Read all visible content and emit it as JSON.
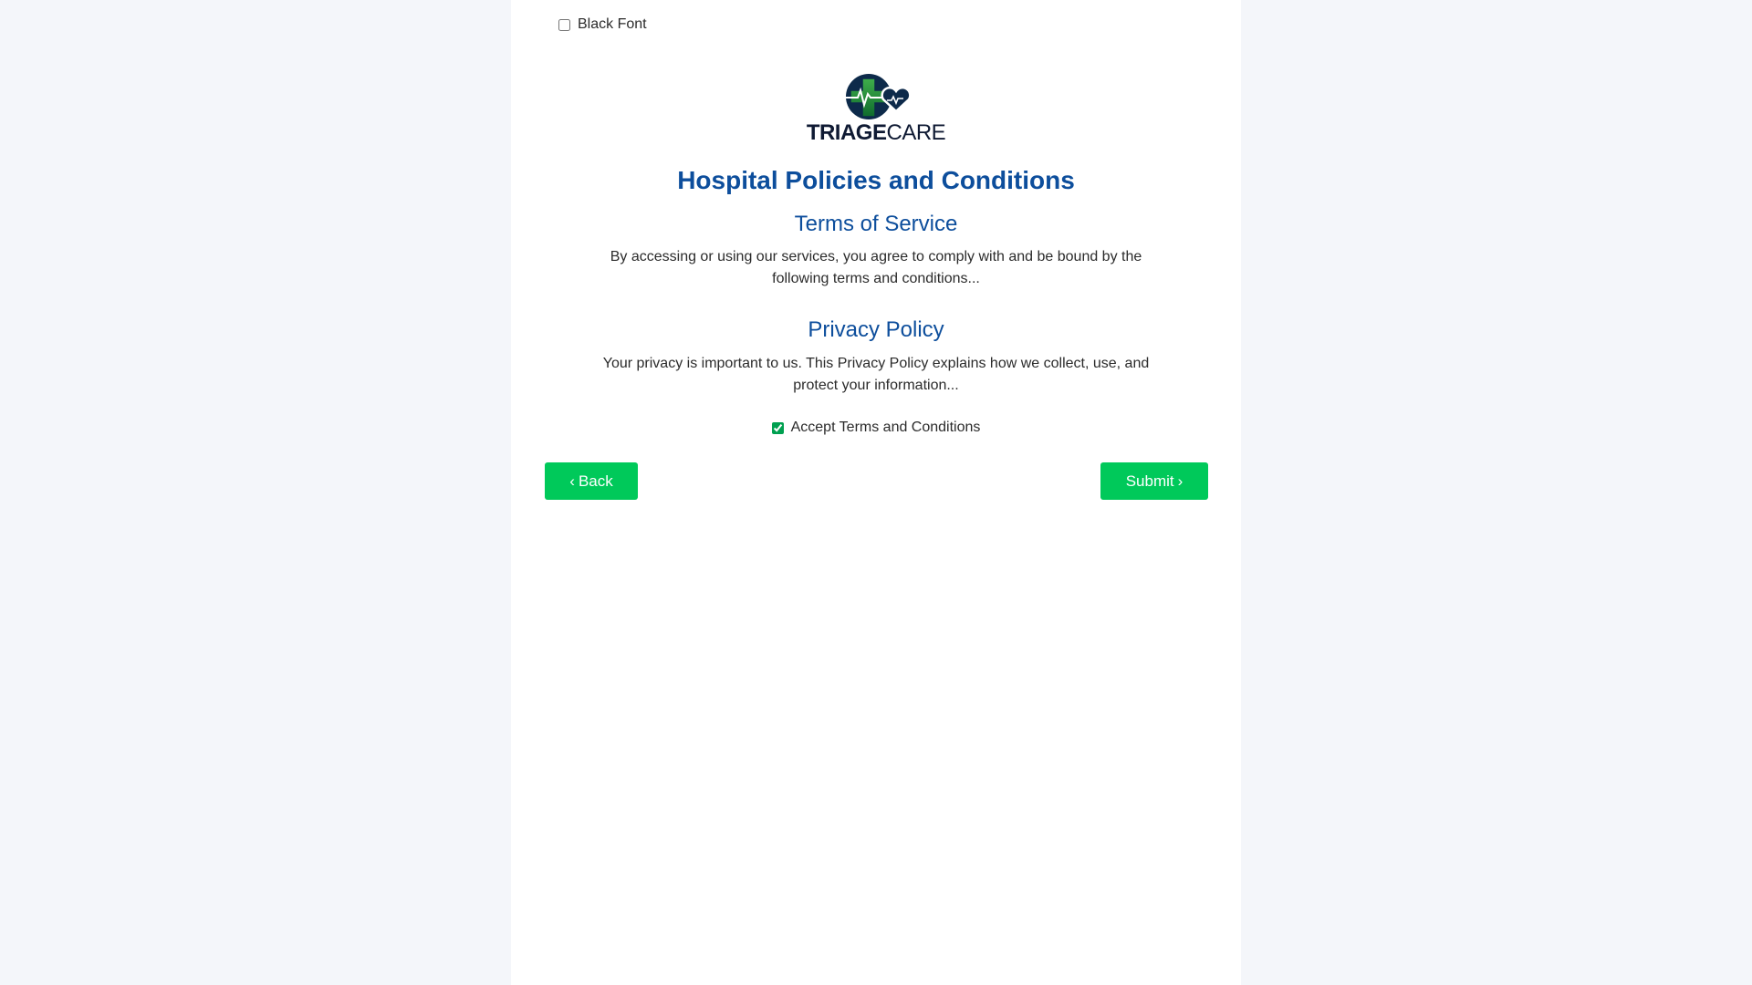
{
  "settings": {
    "black_font_label": "Black Font",
    "black_font_checked": false
  },
  "logo": {
    "name_bold": "TRIAGE",
    "name_light": "CARE",
    "colors": {
      "cross_green": "#1f8a3a",
      "cross_dark": "#0d2a4a",
      "heart": "#0d2a4a",
      "text": "#0f1a33"
    }
  },
  "page": {
    "title": "Hospital Policies and Conditions",
    "accent_color": "#0d4e9c"
  },
  "terms": {
    "heading": "Terms of Service",
    "text": "By accessing or using our services, you agree to comply with and be bound by the following terms and conditions..."
  },
  "privacy": {
    "heading": "Privacy Policy",
    "text": "Your privacy is important to us. This Privacy Policy explains how we collect, use, and protect your information..."
  },
  "accept": {
    "label": "Accept Terms and Conditions",
    "checked": true
  },
  "buttons": {
    "back_label": "Back",
    "submit_label": "Submit",
    "back_icon": "chevron-left-icon",
    "submit_icon": "chevron-right-icon",
    "color": "#00c95a"
  }
}
